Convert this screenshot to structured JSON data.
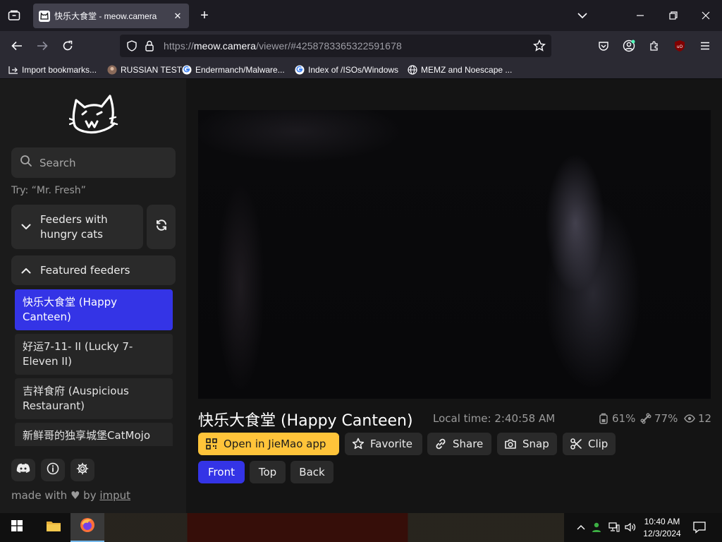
{
  "browser": {
    "tab_title": "快乐大食堂 - meow.camera",
    "url_prefix": "https://",
    "url_host": "meow.camera",
    "url_path": "/viewer/#4258783365322591678",
    "bookmarks": [
      {
        "label": "Import bookmarks...",
        "icon": "import-icon"
      },
      {
        "label": "RUSSIAN TEST",
        "icon": "site-favicon"
      },
      {
        "label": "Endermanch/Malware...",
        "icon": "google-icon"
      },
      {
        "label": "Index of /ISOs/Windows",
        "icon": "google-icon"
      },
      {
        "label": "MEMZ and Noescape ...",
        "icon": "globe-icon"
      }
    ]
  },
  "sidebar": {
    "search_placeholder": "Search",
    "try_hint": "Try: “Mr. Fresh”",
    "hungry_label_line1": "Feeders with",
    "hungry_label_line2": "hungry cats",
    "featured_label": "Featured feeders",
    "feeders": [
      {
        "line1": "快乐大食堂 (Happy",
        "line2": "Canteen)",
        "active": true
      },
      {
        "line1": "好运7-11- II  (Lucky 7-",
        "line2": "Eleven II)",
        "active": false
      },
      {
        "line1": "吉祥食府 (Auspicious",
        "line2": "Restaurant)",
        "active": false
      },
      {
        "line1": "新鲜哥的独享城堡CatMojo",
        "line2": "",
        "active": false
      }
    ],
    "made_with_prefix": "made with",
    "made_with_by": "by",
    "made_with_author": "imput"
  },
  "viewer": {
    "title": "快乐大食堂 (Happy Canteen)",
    "local_time": "Local time: 2:40:58 AM",
    "stats": {
      "food": "61%",
      "other": "77%",
      "viewers": "12"
    },
    "actions": {
      "open_app": "Open in JieMao app",
      "favorite": "Favorite",
      "share": "Share",
      "snap": "Snap",
      "clip": "Clip"
    },
    "views": {
      "front": "Front",
      "top": "Top",
      "back": "Back"
    }
  },
  "taskbar": {
    "time": "10:40 AM",
    "date": "12/3/2024"
  },
  "colors": {
    "accent_blue": "#3434e6",
    "accent_yellow": "#ffc43a"
  }
}
